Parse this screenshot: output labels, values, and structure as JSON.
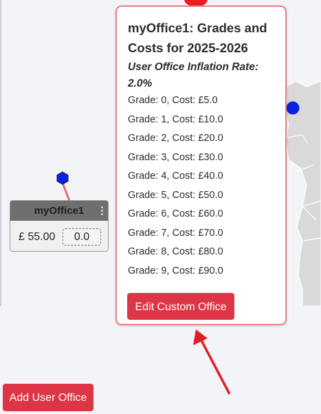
{
  "office_node": {
    "name": "myOffice1",
    "menu_icon": "kebab-icon",
    "cost": "£ 55.00",
    "grade_value": "0.0"
  },
  "popup": {
    "title": "myOffice1: Grades and Costs for 2025-2026",
    "subtitle": "User Office Inflation Rate: 2.0%",
    "grades": [
      "Grade: 0, Cost: £5.0",
      "Grade: 1, Cost: £10.0",
      "Grade: 2, Cost: £20.0",
      "Grade: 3, Cost: £30.0",
      "Grade: 4, Cost: £40.0",
      "Grade: 5, Cost: £50.0",
      "Grade: 6, Cost: £60.0",
      "Grade: 7, Cost: £70.0",
      "Grade: 8, Cost: £80.0",
      "Grade: 9, Cost: £90.0"
    ],
    "edit_button": "Edit Custom Office"
  },
  "add_button": "Add User Office",
  "colors": {
    "accent_red": "#dd3545",
    "popup_border": "#e98080",
    "arrow": "#e01e26",
    "marker_blue": "#0a22e0",
    "node_header": "#6f6f6f"
  }
}
